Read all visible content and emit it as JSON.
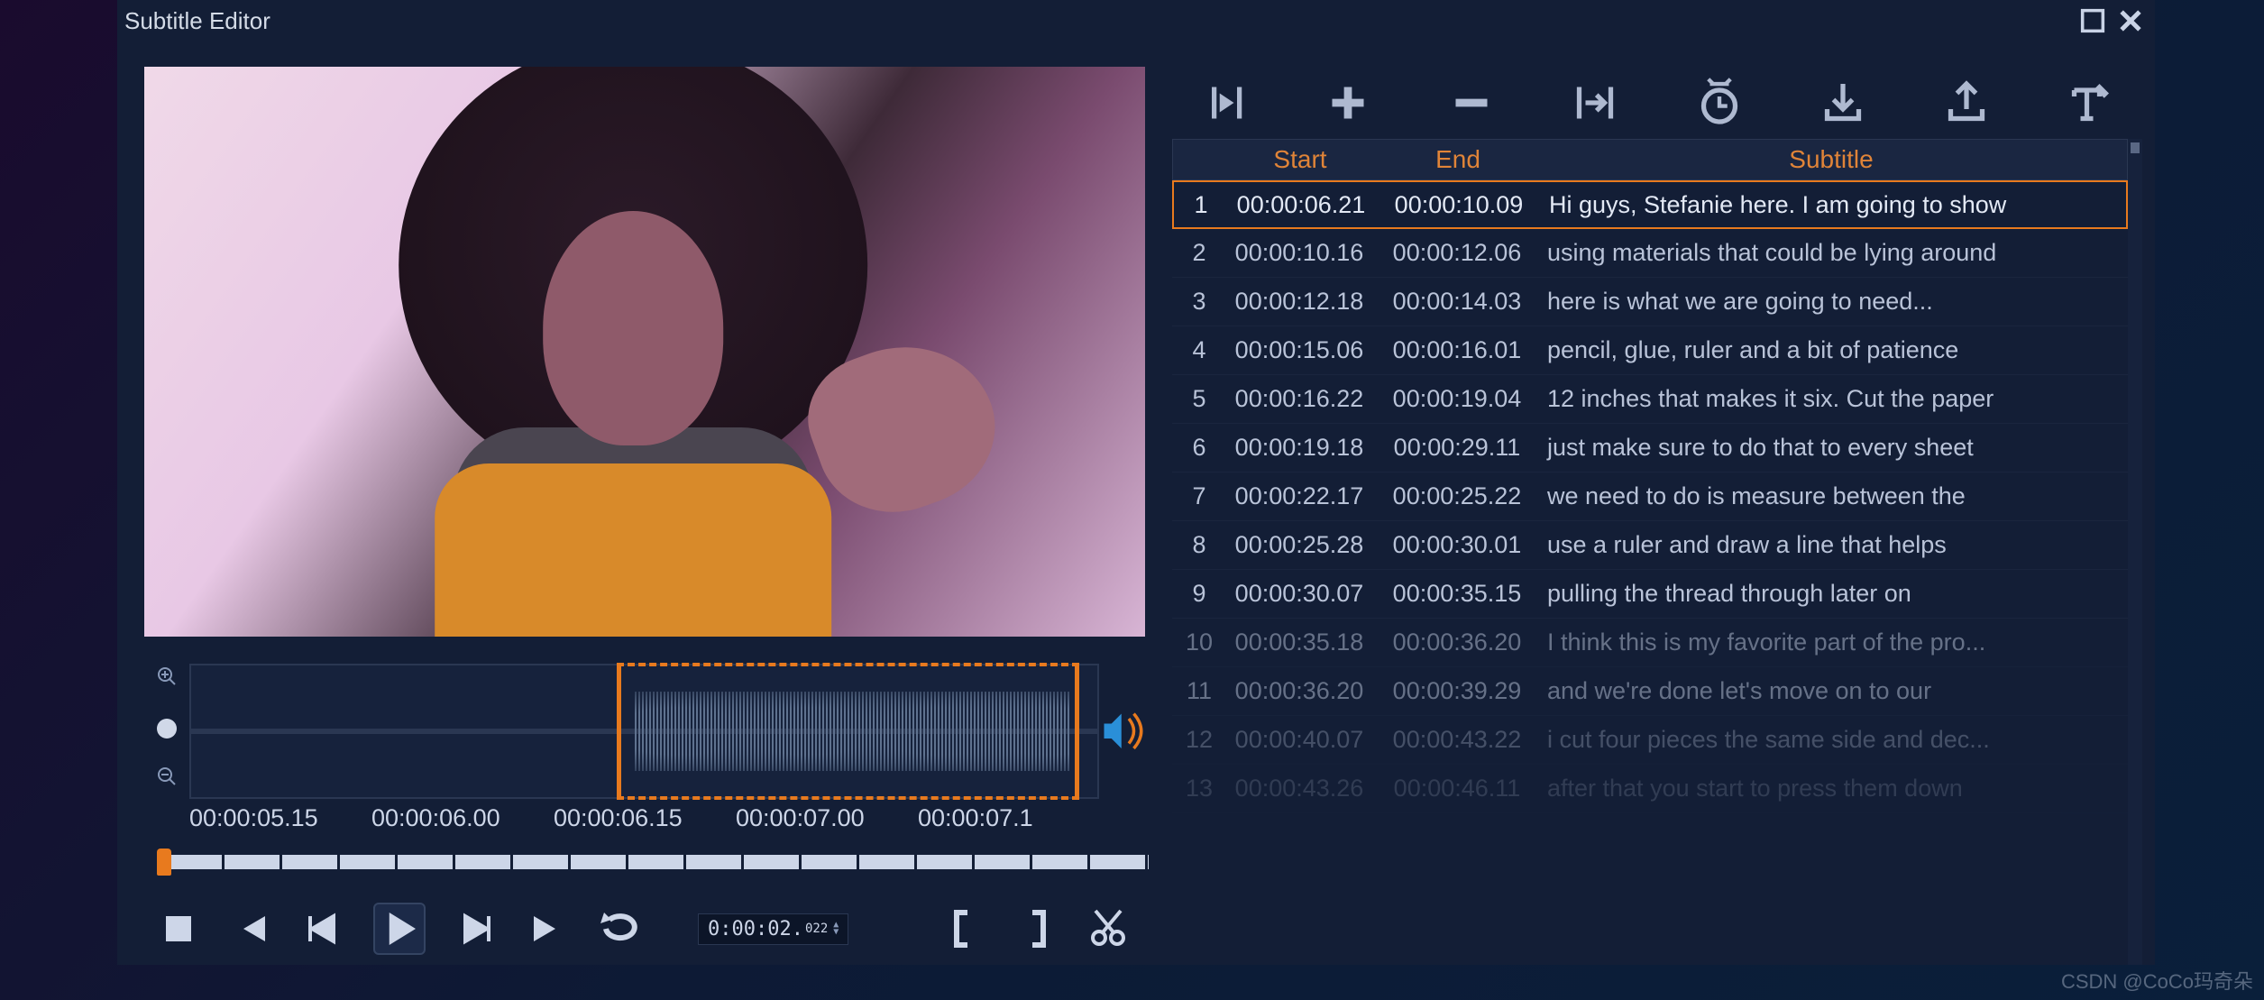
{
  "window": {
    "title": "Subtitle Editor"
  },
  "table": {
    "headers": {
      "start": "Start",
      "end": "End",
      "subtitle": "Subtitle"
    },
    "rows": [
      {
        "n": "1",
        "start": "00:00:06.21",
        "end": "00:00:10.09",
        "text": "Hi guys, Stefanie here. I am going to show"
      },
      {
        "n": "2",
        "start": "00:00:10.16",
        "end": "00:00:12.06",
        "text": "using materials that could be lying around"
      },
      {
        "n": "3",
        "start": "00:00:12.18",
        "end": "00:00:14.03",
        "text": "here is what we are going to need..."
      },
      {
        "n": "4",
        "start": "00:00:15.06",
        "end": "00:00:16.01",
        "text": "pencil, glue, ruler and a bit of patience"
      },
      {
        "n": "5",
        "start": "00:00:16.22",
        "end": "00:00:19.04",
        "text": "12 inches that makes it six. Cut the paper"
      },
      {
        "n": "6",
        "start": "00:00:19.18",
        "end": "00:00:29.11",
        "text": "just make sure to do that to every sheet"
      },
      {
        "n": "7",
        "start": "00:00:22.17",
        "end": "00:00:25.22",
        "text": "we need to do is measure between the"
      },
      {
        "n": "8",
        "start": "00:00:25.28",
        "end": "00:00:30.01",
        "text": "use a ruler and draw a line that helps"
      },
      {
        "n": "9",
        "start": "00:00:30.07",
        "end": "00:00:35.15",
        "text": "pulling the thread through later on"
      },
      {
        "n": "10",
        "start": "00:00:35.18",
        "end": "00:00:36.20",
        "text": "I think this is my favorite part of the pro..."
      },
      {
        "n": "11",
        "start": "00:00:36.20",
        "end": "00:00:39.29",
        "text": "and we're done let's move on to our"
      },
      {
        "n": "12",
        "start": "00:00:40.07",
        "end": "00:00:43.22",
        "text": "i cut four pieces the same side and dec..."
      },
      {
        "n": "13",
        "start": "00:00:43.26",
        "end": "00:00:46.11",
        "text": "after that you start to press them down"
      }
    ]
  },
  "timeline": {
    "ticks": [
      "00:00:05.15",
      "00:00:06.00",
      "00:00:06.15",
      "00:00:07.00",
      "00:00:07.1"
    ]
  },
  "transport": {
    "time_major": "0:00:02.",
    "time_minor": "022"
  },
  "colors": {
    "accent": "#e87a1e",
    "bg": "#131e36"
  },
  "watermark": "CSDN @CoCo玛奇朵"
}
